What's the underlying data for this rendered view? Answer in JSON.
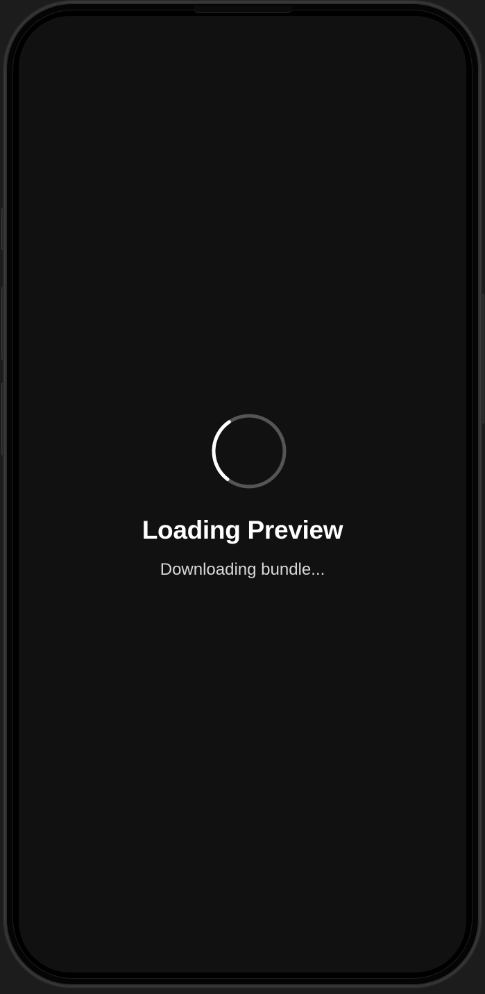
{
  "loading": {
    "title": "Loading Preview",
    "status": "Downloading bundle...",
    "spinner_icon": "loading-spinner-icon"
  },
  "colors": {
    "background": "#111111",
    "text_primary": "#ffffff",
    "text_secondary": "#d8d8d8",
    "spinner_track": "#555555",
    "spinner_arc": "#ffffff"
  }
}
